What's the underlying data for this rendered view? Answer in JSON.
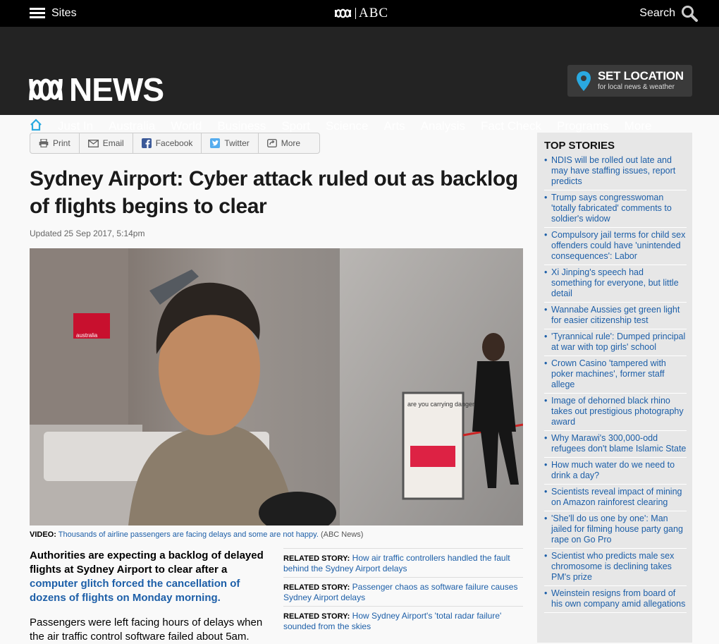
{
  "topbar": {
    "sites_label": "Sites",
    "abc_label": "ABC",
    "search_label": "Search"
  },
  "header": {
    "logo_text": "NEWS",
    "set_location": {
      "title": "SET LOCATION",
      "subtitle": "for local news & weather"
    }
  },
  "nav": {
    "items": [
      "Just In",
      "Australia",
      "World",
      "Business",
      "Sport",
      "Science",
      "Arts",
      "Analysis",
      "Fact Check",
      "Programs",
      "More"
    ]
  },
  "share": {
    "buttons": [
      {
        "label": "Print",
        "icon": "print-icon"
      },
      {
        "label": "Email",
        "icon": "email-icon"
      },
      {
        "label": "Facebook",
        "icon": "facebook-icon"
      },
      {
        "label": "Twitter",
        "icon": "twitter-icon"
      },
      {
        "label": "More",
        "icon": "more-icon"
      }
    ]
  },
  "article": {
    "title": "Sydney Airport: Cyber attack ruled out as backlog of flights begins to clear",
    "updated": "Updated 25 Sep 2017, 5:14pm",
    "photo_sign": "are you carrying dangerous goods?",
    "photo_airline_logo": "australia",
    "caption": {
      "prefix": "VIDEO:",
      "text": "Thousands of airline passengers are facing delays and some are not happy.",
      "source": "(ABC News)"
    },
    "lead_plain": "Authorities are expecting a backlog of delayed flights at Sydney Airport to clear after a",
    "lead_link": "computer glitch forced the cancellation of dozens of flights on Monday morning.",
    "paragraph": "Passengers were left facing hours of delays when the air traffic control software failed about 5am."
  },
  "related": {
    "label": "RELATED STORY:",
    "stories": [
      "How air traffic controllers handled the fault behind the Sydney Airport delays",
      "Passenger chaos as software failure causes Sydney Airport delays",
      "How Sydney Airport's 'total radar failure' sounded from the skies"
    ]
  },
  "top_stories": {
    "heading": "TOP STORIES",
    "items": [
      "NDIS will be rolled out late and may have staffing issues, report predicts",
      "Trump says congresswoman 'totally fabricated' comments to soldier's widow",
      "Compulsory jail terms for child sex offenders could have 'unintended consequences': Labor",
      "Xi Jinping's speech had something for everyone, but little detail",
      "Wannabe Aussies get green light for easier citizenship test",
      "'Tyrannical rule': Dumped principal at war with top girls' school",
      "Crown Casino 'tampered with poker machines', former staff allege",
      "Image of dehorned black rhino takes out prestigious photography award",
      "Why Marawi's 300,000-odd refugees don't blame Islamic State",
      "How much water do we need to drink a day?",
      "Scientists reveal impact of mining on Amazon rainforest clearing",
      "'She'll do us one by one': Man jailed for filming house party gang rape on Go Pro",
      "Scientist who predicts male sex chromosome is declining takes PM's prize",
      "Weinstein resigns from board of his own company amid allegations"
    ]
  },
  "colors": {
    "link": "#1d5fa8",
    "header_bg": "#232323",
    "topbar_bg": "#000000",
    "sidebar_bg": "#e7e7e7",
    "home_icon": "#2aa9e0",
    "pin": "#2aa9e0"
  }
}
